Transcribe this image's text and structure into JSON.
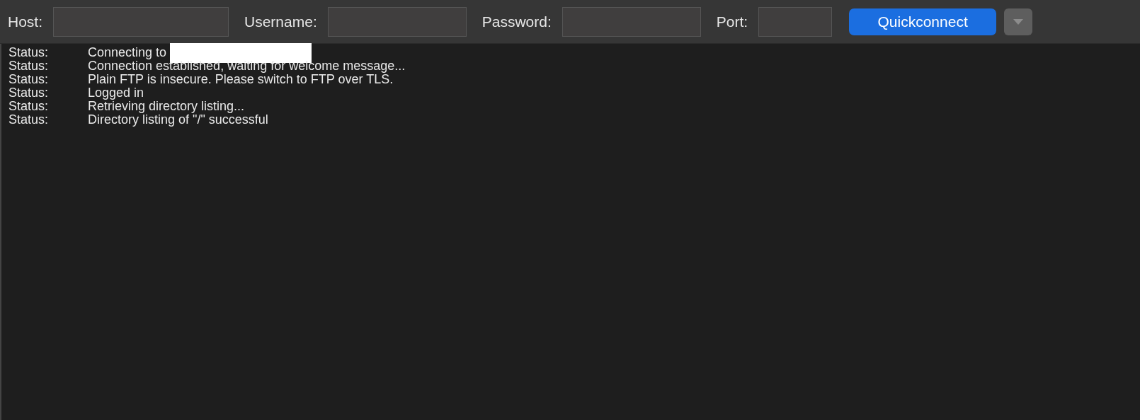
{
  "quickconnect_bar": {
    "fields": [
      {
        "label": "Host:"
      },
      {
        "label": "Username:"
      },
      {
        "label": "Password:"
      },
      {
        "label": "Port:"
      }
    ],
    "connect_button": "Quickconnect"
  },
  "message_log": [
    {
      "type": "Status:",
      "message": "Connecting to",
      "redacted": true
    },
    {
      "type": "Status:",
      "message": "Connection established, waiting for welcome message...",
      "redacted": false
    },
    {
      "type": "Status:",
      "message": "Plain FTP is insecure. Please switch to FTP over TLS.",
      "redacted": false
    },
    {
      "type": "Status:",
      "message": "Logged in",
      "redacted": false
    },
    {
      "type": "Status:",
      "message": "Retrieving directory listing...",
      "redacted": false
    },
    {
      "type": "Status:",
      "message": "Directory listing of \"/\" successful",
      "redacted": false
    }
  ]
}
